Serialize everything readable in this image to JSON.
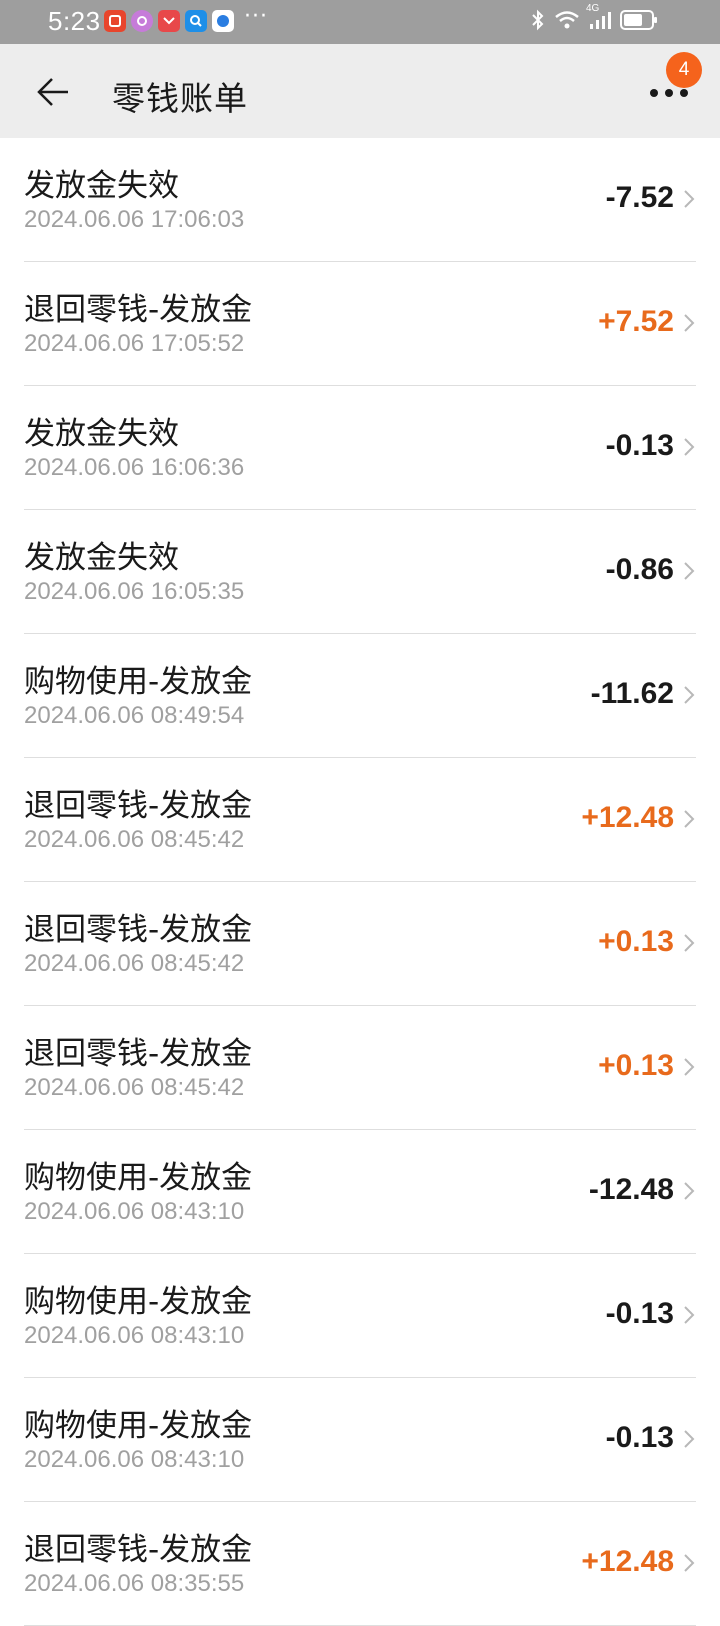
{
  "status_bar": {
    "time": "5:23",
    "more": "···",
    "network": "4G"
  },
  "header": {
    "title": "零钱账单",
    "badge_count": "4"
  },
  "colors": {
    "header_bg": "#ededed",
    "status_bg": "#9e9e9e",
    "positive_amount": "#e86a1c",
    "negative_amount": "#1a1a1a",
    "badge": "#f5631c"
  },
  "transactions": [
    {
      "title": "发放金失效",
      "time": "2024.06.06 17:06:03",
      "amount": "-7.52"
    },
    {
      "title": "退回零钱-发放金",
      "time": "2024.06.06 17:05:52",
      "amount": "+7.52"
    },
    {
      "title": "发放金失效",
      "time": "2024.06.06 16:06:36",
      "amount": "-0.13"
    },
    {
      "title": "发放金失效",
      "time": "2024.06.06 16:05:35",
      "amount": "-0.86"
    },
    {
      "title": "购物使用-发放金",
      "time": "2024.06.06 08:49:54",
      "amount": "-11.62"
    },
    {
      "title": "退回零钱-发放金",
      "time": "2024.06.06 08:45:42",
      "amount": "+12.48"
    },
    {
      "title": "退回零钱-发放金",
      "time": "2024.06.06 08:45:42",
      "amount": "+0.13"
    },
    {
      "title": "退回零钱-发放金",
      "time": "2024.06.06 08:45:42",
      "amount": "+0.13"
    },
    {
      "title": "购物使用-发放金",
      "time": "2024.06.06 08:43:10",
      "amount": "-12.48"
    },
    {
      "title": "购物使用-发放金",
      "time": "2024.06.06 08:43:10",
      "amount": "-0.13"
    },
    {
      "title": "购物使用-发放金",
      "time": "2024.06.06 08:43:10",
      "amount": "-0.13"
    },
    {
      "title": "退回零钱-发放金",
      "time": "2024.06.06 08:35:55",
      "amount": "+12.48"
    }
  ]
}
